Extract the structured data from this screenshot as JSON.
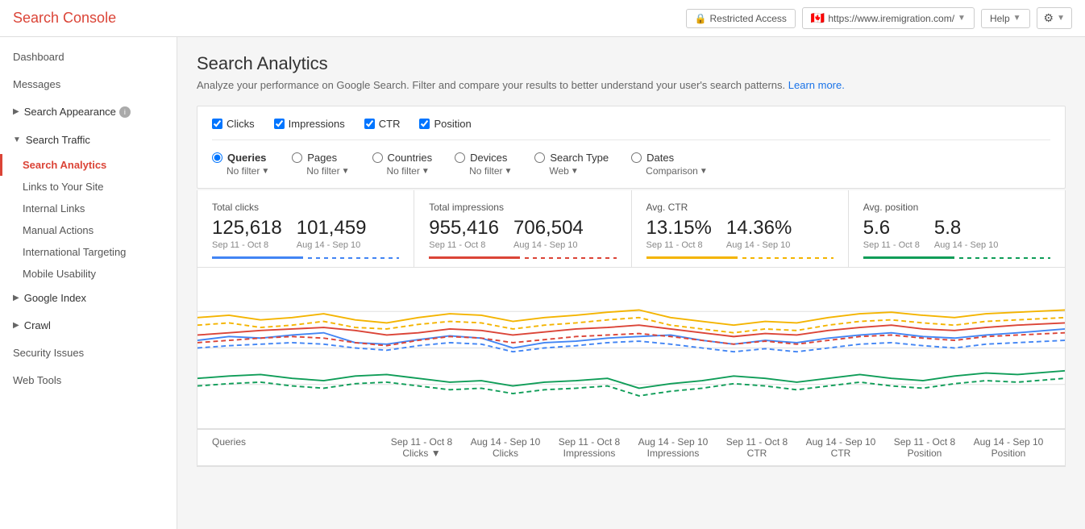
{
  "topbar": {
    "title": "Search Console",
    "restricted_label": "Restricted Access",
    "url": "https://www.iremigration.com/",
    "help_label": "Help",
    "gear_label": "⚙"
  },
  "sidebar": {
    "dashboard": "Dashboard",
    "messages": "Messages",
    "search_appearance": "Search Appearance",
    "search_traffic": "Search Traffic",
    "search_traffic_children": [
      {
        "label": "Search Analytics",
        "active": true
      },
      {
        "label": "Links to Your Site",
        "active": false
      },
      {
        "label": "Internal Links",
        "active": false
      },
      {
        "label": "Manual Actions",
        "active": false
      },
      {
        "label": "International Targeting",
        "active": false
      },
      {
        "label": "Mobile Usability",
        "active": false
      }
    ],
    "google_index": "Google Index",
    "crawl": "Crawl",
    "security_issues": "Security Issues",
    "web_tools": "Web Tools"
  },
  "page": {
    "title": "Search Analytics",
    "description": "Analyze your performance on Google Search. Filter and compare your results to better understand your user's search patterns.",
    "learn_more": "Learn more."
  },
  "filters": {
    "checkboxes": [
      {
        "label": "Clicks",
        "checked": true
      },
      {
        "label": "Impressions",
        "checked": true
      },
      {
        "label": "CTR",
        "checked": true
      },
      {
        "label": "Position",
        "checked": true
      }
    ],
    "radios": [
      {
        "label": "Queries",
        "sub": "No filter",
        "selected": true
      },
      {
        "label": "Pages",
        "sub": "No filter",
        "selected": false
      },
      {
        "label": "Countries",
        "sub": "No filter",
        "selected": false
      },
      {
        "label": "Devices",
        "sub": "No filter",
        "selected": false
      },
      {
        "label": "Search Type",
        "sub": "Web",
        "selected": false
      },
      {
        "label": "Dates",
        "sub": "Comparison",
        "selected": false
      }
    ]
  },
  "stats": [
    {
      "label": "Total clicks",
      "value1": "125,618",
      "date1": "Sep 11 - Oct 8",
      "value2": "101,459",
      "date2": "Aug 14 - Sep 10",
      "line_color": "blue"
    },
    {
      "label": "Total impressions",
      "value1": "955,416",
      "date1": "Sep 11 - Oct 8",
      "value2": "706,504",
      "date2": "Aug 14 - Sep 10",
      "line_color": "red"
    },
    {
      "label": "Avg. CTR",
      "value1": "13.15%",
      "date1": "Sep 11 - Oct 8",
      "value2": "14.36%",
      "date2": "Aug 14 - Sep 10",
      "line_color": "yellow"
    },
    {
      "label": "Avg. position",
      "value1": "5.6",
      "date1": "Sep 11 - Oct 8",
      "value2": "5.8",
      "date2": "Aug 14 - Sep 10",
      "line_color": "green"
    }
  ],
  "table": {
    "columns": [
      {
        "label": "Queries"
      },
      {
        "label": "Sep 11 - Oct 8\nClicks ▼"
      },
      {
        "label": "Aug 14 - Sep 10\nClicks"
      },
      {
        "label": "Sep 11 - Oct 8\nImpressions"
      },
      {
        "label": "Aug 14 - Sep 10\nImpressions"
      },
      {
        "label": "Sep 11 - Oct 8\nCTR"
      },
      {
        "label": "Aug 14 - Sep 10\nCTR"
      },
      {
        "label": "Sep 11 - Oct 8\nPosition"
      },
      {
        "label": "Aug 14 - Sep 10\nPosition"
      }
    ]
  }
}
